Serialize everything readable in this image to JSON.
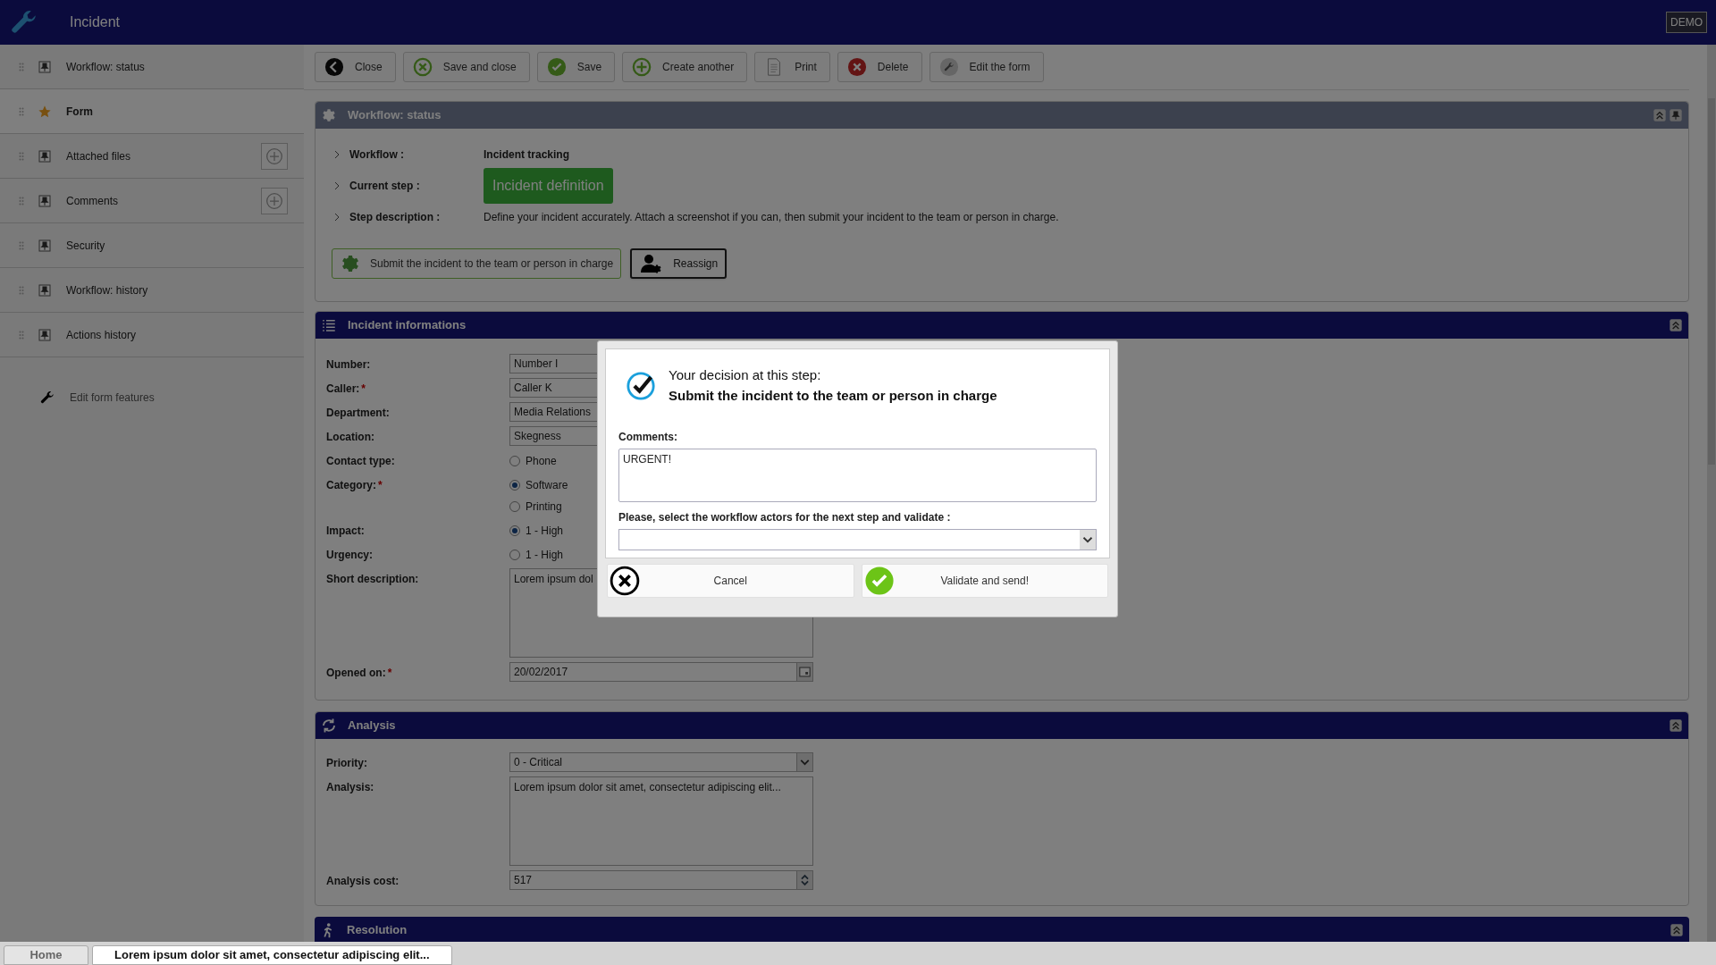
{
  "header": {
    "title": "Incident",
    "badge": "DEMO"
  },
  "sidebar": {
    "items": [
      {
        "label": "Workflow: status",
        "kind": "pin",
        "selected": false,
        "add_button": false
      },
      {
        "label": "Form",
        "kind": "star",
        "selected": true,
        "add_button": false
      },
      {
        "label": "Attached files",
        "kind": "pin",
        "selected": false,
        "add_button": true
      },
      {
        "label": "Comments",
        "kind": "pin",
        "selected": false,
        "add_button": true
      },
      {
        "label": "Security",
        "kind": "pin",
        "selected": false,
        "add_button": false
      },
      {
        "label": "Workflow: history",
        "kind": "pin",
        "selected": false,
        "add_button": false
      },
      {
        "label": "Actions history",
        "kind": "pin",
        "selected": false,
        "add_button": false
      }
    ],
    "footer_link": "Edit form features"
  },
  "toolbar": [
    {
      "label": "Close",
      "kind": "back"
    },
    {
      "label": "Save and close",
      "kind": "save-close"
    },
    {
      "label": "Save",
      "kind": "save"
    },
    {
      "label": "Create another",
      "kind": "create"
    },
    {
      "label": "Print",
      "kind": "print"
    },
    {
      "label": "Delete",
      "kind": "delete"
    },
    {
      "label": "Edit the form",
      "kind": "edit"
    }
  ],
  "workflow_panel": {
    "title": "Workflow: status",
    "rows": [
      {
        "label": "Workflow :",
        "value": "Incident tracking",
        "kind": "bold"
      },
      {
        "label": "Current step :",
        "value": "Incident definition",
        "kind": "badge"
      },
      {
        "label": "Step description :",
        "value": "Define your incident accurately. Attach a screenshot if you can, then submit your incident to the team or person in charge.",
        "kind": "plain"
      }
    ],
    "actions": [
      {
        "label": "Submit the incident to the team or person in charge",
        "kind": "submit"
      },
      {
        "label": "Reassign",
        "kind": "reassign"
      }
    ]
  },
  "info_panel": {
    "title": "Incident informations",
    "fields": [
      {
        "label": "Number:",
        "kind": "input",
        "value": "Number I"
      },
      {
        "label": "Caller:",
        "required_mark": "*",
        "kind": "input",
        "value": "Caller K"
      },
      {
        "label": "Department:",
        "kind": "input",
        "value": "Media Relations"
      },
      {
        "label": "Location:",
        "kind": "input",
        "value": "Skegness"
      },
      {
        "label": "Contact type:",
        "kind": "radio",
        "options": [
          {
            "label": "Phone",
            "selected": false
          }
        ]
      },
      {
        "label": "Category:",
        "required_mark": "*",
        "kind": "radio",
        "options": [
          {
            "label": "Software",
            "selected": true
          },
          {
            "label": "Printing",
            "selected": false
          }
        ]
      },
      {
        "label": "Impact:",
        "kind": "radio",
        "options": [
          {
            "label": "1 - High",
            "selected": true
          }
        ]
      },
      {
        "label": "Urgency:",
        "kind": "radio",
        "options": [
          {
            "label": "1 - High",
            "selected": false
          }
        ]
      },
      {
        "label": "Short description:",
        "kind": "textarea",
        "value": "Lorem ipsum dol"
      },
      {
        "label": "Opened on:",
        "required_mark": "*",
        "kind": "date",
        "value": "20/02/2017"
      }
    ]
  },
  "analysis_panel": {
    "title": "Analysis",
    "fields": [
      {
        "label": "Priority:",
        "kind": "select",
        "value": "0 - Critical"
      },
      {
        "label": "Analysis:",
        "kind": "textarea",
        "value": "Lorem ipsum dolor sit amet, consectetur adipiscing elit..."
      },
      {
        "label": "Analysis cost:",
        "kind": "number",
        "value": "517"
      }
    ]
  },
  "resolution_panel": {
    "title": "Resolution"
  },
  "dialog": {
    "heading": "Your decision at this step:",
    "decision": "Submit the incident to the team or person in charge",
    "comments_label": "Comments:",
    "comments": "URGENT!",
    "actors_label": "Please, select the workflow actors for the next step and validate :",
    "buttons": [
      {
        "label": "Cancel",
        "kind": "cancel"
      },
      {
        "label": "Validate and send!",
        "kind": "validate"
      }
    ]
  },
  "taskbar": [
    {
      "label": "Home",
      "selected": false
    },
    {
      "label": "Lorem ipsum dolor sit amet, consectetur adipiscing elit...",
      "selected": true
    }
  ]
}
